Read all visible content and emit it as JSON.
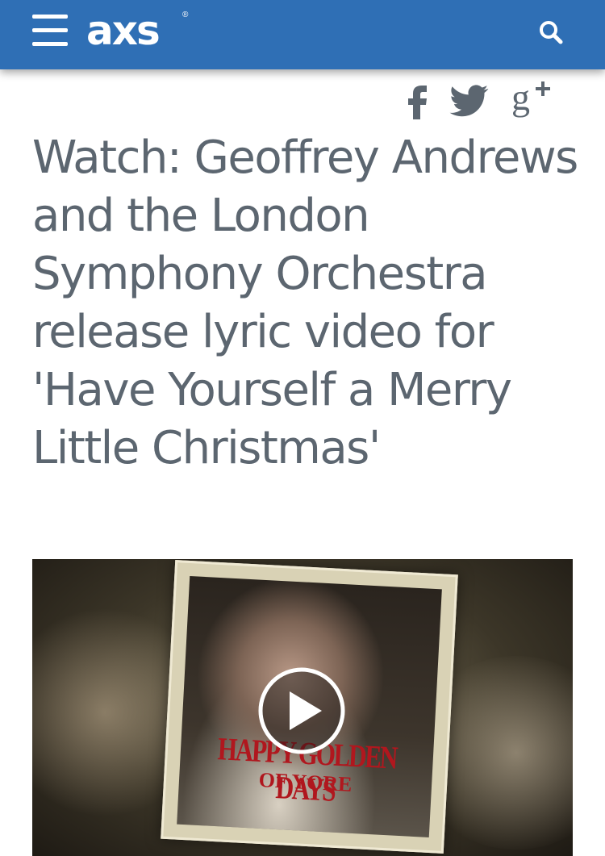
{
  "header": {
    "logo_text": "axs",
    "logo_reg": "®",
    "menu_icon": "hamburger-menu-icon",
    "search_icon": "search-icon",
    "bar_color": "#2f6fb5"
  },
  "share": {
    "facebook_label": "f",
    "google_plus_label": "g+",
    "icon_color": "#5c6670"
  },
  "article": {
    "title": "Watch: Geoffrey Andrews and the London Symphony Orchestra release lyric video for 'Have Yourself a Merry Little Christmas'",
    "title_color": "#5c6670"
  },
  "video": {
    "caption_line1": "HAPPY GOLDEN DAYS",
    "caption_line2": "OF YORE",
    "play_icon": "play-button-icon"
  }
}
